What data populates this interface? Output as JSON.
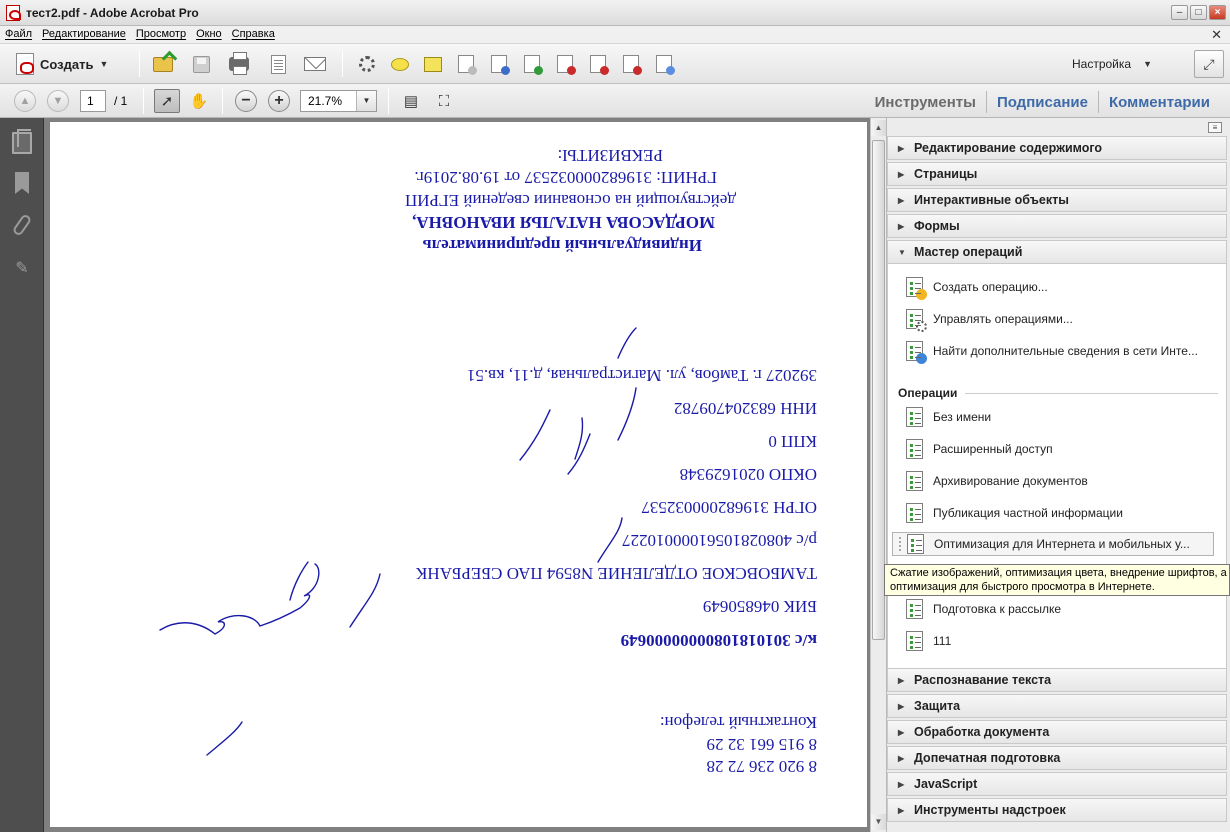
{
  "window": {
    "title": "тест2.pdf - Adobe Acrobat Pro"
  },
  "menu": [
    "Файл",
    "Редактирование",
    "Просмотр",
    "Окно",
    "Справка"
  ],
  "toolbar": {
    "create_label": "Создать",
    "settings_label": "Настройка"
  },
  "nav": {
    "page_current": "1",
    "page_total": "/ 1",
    "zoom": "21.7%"
  },
  "panel_tabs": [
    "Инструменты",
    "Подписание",
    "Комментарии"
  ],
  "document": {
    "lines": [
      "Индивидуальный предприниматель",
      "МОРДАСОВА НАТАЛЬЯ ИВАНОВНА,",
      "действующий на основании сведений ЕГРИП",
      "ГРНИП: 319682000032537 от 19.08.2019г.",
      "РЕКВИЗИТЫ:",
      "392027 г. Тамбов, ул. Магистральная, д.11, кв.51",
      "ИНН 683204709782",
      "КПП 0",
      "ОКПО 0201629348",
      "ОГРН 319682000032537",
      "р/с 40802810561000010227",
      "ТАМБОВСКОЕ ОТДЕЛЕНИЕ N8594 ПАО СБЕРБАНК",
      "БИК 046850649",
      "к/с  30101810800000000649",
      "Контактный телефон:",
      "8 915 661 32 29",
      "8 920 236 72 28"
    ]
  },
  "tools_panel": {
    "sections_top": [
      "Редактирование содержимого",
      "Страницы",
      "Интерактивные объекты",
      "Формы",
      "Мастер операций"
    ],
    "wizard_actions": [
      "Создать операцию...",
      "Управлять операциями...",
      "Найти дополнительные сведения в сети Инте..."
    ],
    "operations_title": "Операции",
    "operations": [
      "Без имени",
      "Расширенный доступ",
      "Архивирование документов",
      "Публикация частной информации",
      "Оптимизация для Интернета и мобильных у...",
      "Подготовка к рассылке",
      "111"
    ],
    "sections_bottom": [
      "Распознавание текста",
      "Защита",
      "Обработка документа",
      "Допечатная подготовка",
      "JavaScript",
      "Инструменты надстроек"
    ]
  },
  "tooltip": {
    "line1": "Сжатие изображений, оптимизация цвета, внедрение шрифтов, а т",
    "line2": "оптимизация для быстрого просмотра в Интернете."
  }
}
